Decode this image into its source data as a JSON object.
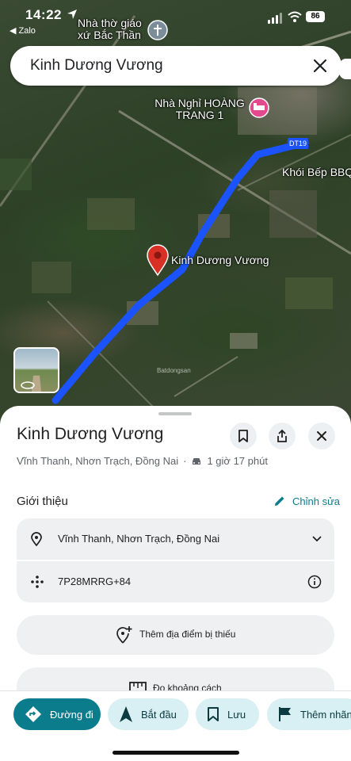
{
  "status_bar": {
    "time": "14:22",
    "back_app": "Zalo",
    "battery": "86"
  },
  "map": {
    "poi_church": "Nhà thờ giáo xứ Bắc Thần",
    "poi_hotel": "Nhà Nghỉ HOÀNG TRANG 1",
    "poi_restaurant": "Khói Bếp BBQ lẩu - nướng",
    "road_shield": "DT19",
    "route_label": "Kinh Dương Vương",
    "watermark": "Batdongsan",
    "route_color": "#1a53ff",
    "pin_color": "#d93025"
  },
  "search": {
    "query": "Kinh Dương Vương"
  },
  "sheet": {
    "title": "Kinh Dương Vương",
    "location": "Vĩnh Thanh, Nhơn Trạch, Đồng Nai",
    "separator": "·",
    "travel_time": "1 giờ 17 phút",
    "section_title": "Giới thiệu",
    "edit_label": "Chỉnh sửa",
    "address_row": "Vĩnh Thanh, Nhơn Trạch, Đồng Nai",
    "plus_code": "7P28MRRG+84",
    "add_missing_place": "Thêm địa điểm bị thiếu",
    "measure_distance": "Đo khoảng cách"
  },
  "actions": {
    "directions": "Đường đi",
    "start": "Bắt đầu",
    "save": "Lưu",
    "add_label": "Thêm nhãn"
  },
  "colors": {
    "accent": "#0b7c8c",
    "chip_bg": "#d8f0f3"
  }
}
